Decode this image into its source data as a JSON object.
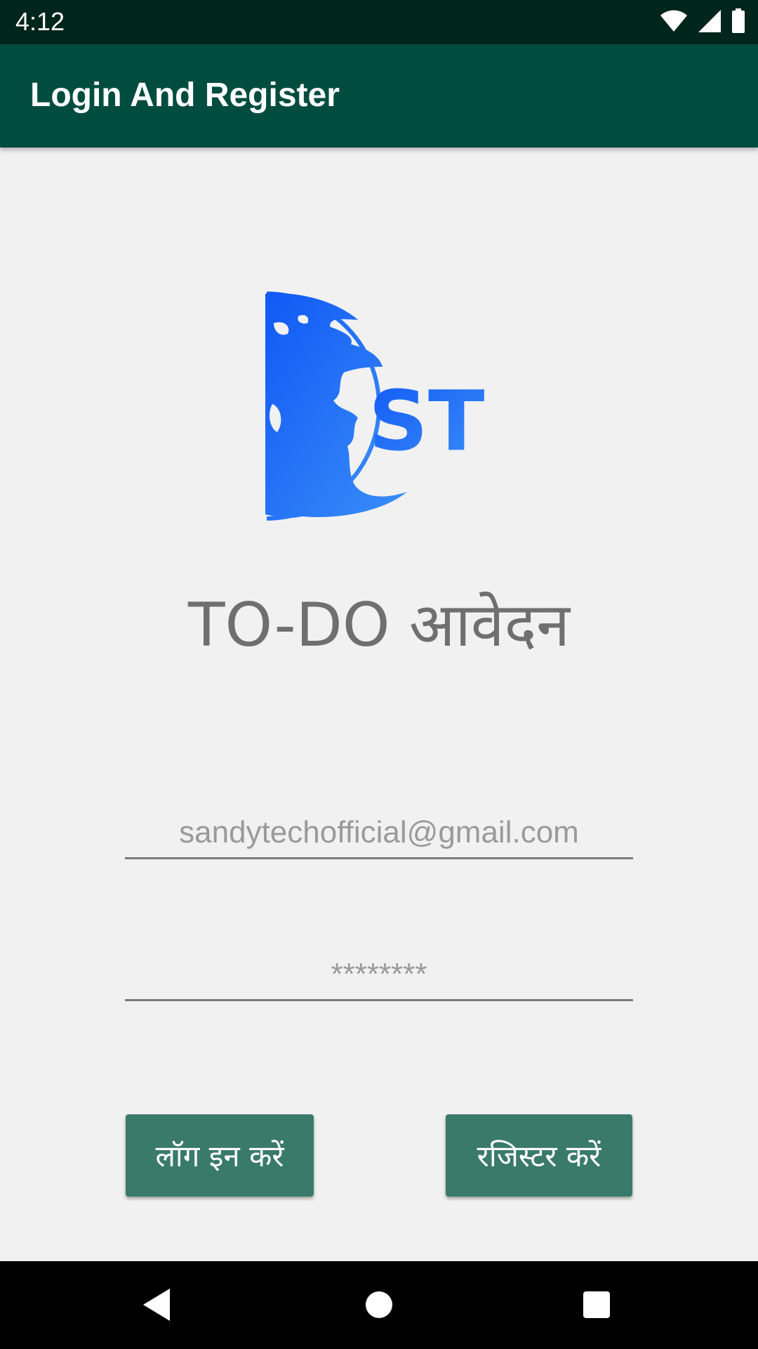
{
  "status_bar": {
    "time": "4:12"
  },
  "app_bar": {
    "title": "Login And Register"
  },
  "logo": {
    "letters": "ST",
    "colors": [
      "#1159f5",
      "#2f86f7"
    ]
  },
  "headline": "TO-DO आवेदन",
  "form": {
    "email_placeholder": "sandytechofficial@gmail.com",
    "password_placeholder": "********"
  },
  "buttons": {
    "login": "लॉग इन करें",
    "register": "रजिस्टर करें"
  },
  "colors": {
    "status_bar": "#00251a",
    "app_bar": "#004d40",
    "button": "#3a7a6b",
    "background": "#f1f1f1"
  },
  "icons": {
    "status": [
      "wifi-icon",
      "cell-signal-icon",
      "battery-icon"
    ],
    "nav": [
      "back-icon",
      "home-icon",
      "recents-icon"
    ]
  }
}
